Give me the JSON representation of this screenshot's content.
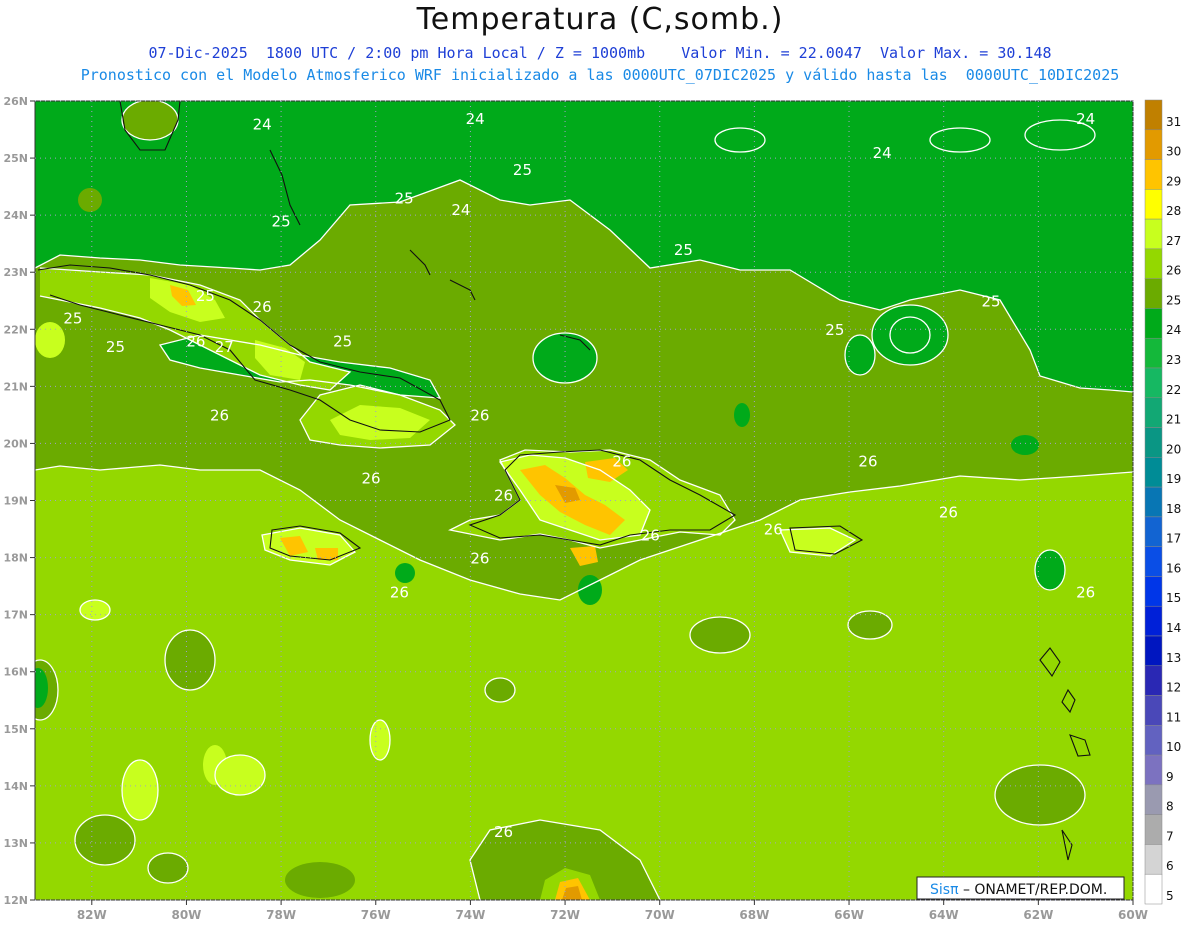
{
  "header": {
    "title": "Temperatura (C,somb.)",
    "subtitle_line1": "07-Dic-2025  1800 UTC / 2:00 pm Hora Local / Z = 1000mb    Valor Min. = 22.0047  Valor Max. = 30.148",
    "subtitle_line2": "Pronostico con el Modelo Atmosferico WRF inicializado a las 0000UTC_07DIC2025 y válido hasta las  0000UTC_10DIC2025"
  },
  "map": {
    "lon_range": [
      -83.2,
      -60
    ],
    "lat_range": [
      12,
      26
    ],
    "x_ticks": [
      {
        "value": -82,
        "label": "82W"
      },
      {
        "value": -80,
        "label": "80W"
      },
      {
        "value": -78,
        "label": "78W"
      },
      {
        "value": -76,
        "label": "76W"
      },
      {
        "value": -74,
        "label": "74W"
      },
      {
        "value": -72,
        "label": "72W"
      },
      {
        "value": -70,
        "label": "70W"
      },
      {
        "value": -68,
        "label": "68W"
      },
      {
        "value": -66,
        "label": "66W"
      },
      {
        "value": -64,
        "label": "64W"
      },
      {
        "value": -62,
        "label": "62W"
      },
      {
        "value": -60,
        "label": "60W"
      }
    ],
    "y_ticks": [
      {
        "value": 26,
        "label": "26N"
      },
      {
        "value": 25,
        "label": "25N"
      },
      {
        "value": 24,
        "label": "24N"
      },
      {
        "value": 23,
        "label": "23N"
      },
      {
        "value": 22,
        "label": "22N"
      },
      {
        "value": 21,
        "label": "21N"
      },
      {
        "value": 20,
        "label": "20N"
      },
      {
        "value": 19,
        "label": "19N"
      },
      {
        "value": 18,
        "label": "18N"
      },
      {
        "value": 17,
        "label": "17N"
      },
      {
        "value": 16,
        "label": "16N"
      },
      {
        "value": 15,
        "label": "15N"
      },
      {
        "value": 14,
        "label": "14N"
      },
      {
        "value": 13,
        "label": "13N"
      },
      {
        "value": 12,
        "label": "12N"
      }
    ],
    "grid": "dotted",
    "contour_labels": [
      {
        "text": "24",
        "lon": -78.4,
        "lat": 25.5
      },
      {
        "text": "24",
        "lon": -73.9,
        "lat": 25.6
      },
      {
        "text": "24",
        "lon": -65.3,
        "lat": 25.0
      },
      {
        "text": "24",
        "lon": -61.0,
        "lat": 25.6
      },
      {
        "text": "24",
        "lon": -74.2,
        "lat": 24.0
      },
      {
        "text": "25",
        "lon": -72.9,
        "lat": 24.7
      },
      {
        "text": "25",
        "lon": -75.4,
        "lat": 24.2
      },
      {
        "text": "25",
        "lon": -78.0,
        "lat": 23.8
      },
      {
        "text": "25",
        "lon": -69.5,
        "lat": 23.3
      },
      {
        "text": "25",
        "lon": -79.6,
        "lat": 22.5
      },
      {
        "text": "25",
        "lon": -82.4,
        "lat": 22.1
      },
      {
        "text": "25",
        "lon": -81.5,
        "lat": 21.6
      },
      {
        "text": "25",
        "lon": -76.7,
        "lat": 21.7
      },
      {
        "text": "25",
        "lon": -66.3,
        "lat": 21.9
      },
      {
        "text": "25",
        "lon": -63.0,
        "lat": 22.4
      },
      {
        "text": "26",
        "lon": -78.4,
        "lat": 22.3
      },
      {
        "text": "26",
        "lon": -79.8,
        "lat": 21.7
      },
      {
        "text": "27",
        "lon": -79.2,
        "lat": 21.6
      },
      {
        "text": "26",
        "lon": -79.3,
        "lat": 20.4
      },
      {
        "text": "26",
        "lon": -73.8,
        "lat": 20.4
      },
      {
        "text": "26",
        "lon": -65.6,
        "lat": 19.6
      },
      {
        "text": "26",
        "lon": -76.1,
        "lat": 19.3
      },
      {
        "text": "26",
        "lon": -73.3,
        "lat": 19.0
      },
      {
        "text": "26",
        "lon": -70.8,
        "lat": 19.6
      },
      {
        "text": "26",
        "lon": -67.6,
        "lat": 18.4
      },
      {
        "text": "26",
        "lon": -63.9,
        "lat": 18.7
      },
      {
        "text": "26",
        "lon": -70.2,
        "lat": 18.3
      },
      {
        "text": "26",
        "lon": -73.8,
        "lat": 17.9
      },
      {
        "text": "26",
        "lon": -75.5,
        "lat": 17.3
      },
      {
        "text": "26",
        "lon": -61.0,
        "lat": 17.3
      },
      {
        "text": "26",
        "lon": -73.3,
        "lat": 13.1
      }
    ]
  },
  "colorbar": {
    "levels": [
      {
        "label": "31",
        "color": "#c08000"
      },
      {
        "label": "30",
        "color": "#e29a00"
      },
      {
        "label": "29",
        "color": "#ffc400"
      },
      {
        "label": "28",
        "color": "#ffff00"
      },
      {
        "label": "27",
        "color": "#c8ff1e"
      },
      {
        "label": "26",
        "color": "#94d800"
      },
      {
        "label": "25",
        "color": "#6bab00"
      },
      {
        "label": "24",
        "color": "#00aa1a"
      },
      {
        "label": "23",
        "color": "#14b83a"
      },
      {
        "label": "22",
        "color": "#16b862"
      },
      {
        "label": "21",
        "color": "#12a874"
      },
      {
        "label": "20",
        "color": "#0a9684"
      },
      {
        "label": "19",
        "color": "#008c96"
      },
      {
        "label": "18",
        "color": "#0876b4"
      },
      {
        "label": "17",
        "color": "#1264d2"
      },
      {
        "label": "16",
        "color": "#0a4ee6"
      },
      {
        "label": "15",
        "color": "#0036e8"
      },
      {
        "label": "14",
        "color": "#0020d8"
      },
      {
        "label": "13",
        "color": "#0016c0"
      },
      {
        "label": "12",
        "color": "#2a28b4"
      },
      {
        "label": "11",
        "color": "#4a48b8"
      },
      {
        "label": "10",
        "color": "#6262c0"
      },
      {
        "label": "9",
        "color": "#7c72c0"
      },
      {
        "label": "8",
        "color": "#9a9ab0"
      },
      {
        "label": "7",
        "color": "#acacac"
      },
      {
        "label": "6",
        "color": "#d4d4d4"
      },
      {
        "label": "5",
        "color": "#ffffff"
      }
    ]
  },
  "credit": {
    "logo": "Sisπ",
    "text": " – ONAMET/REP.DOM."
  }
}
